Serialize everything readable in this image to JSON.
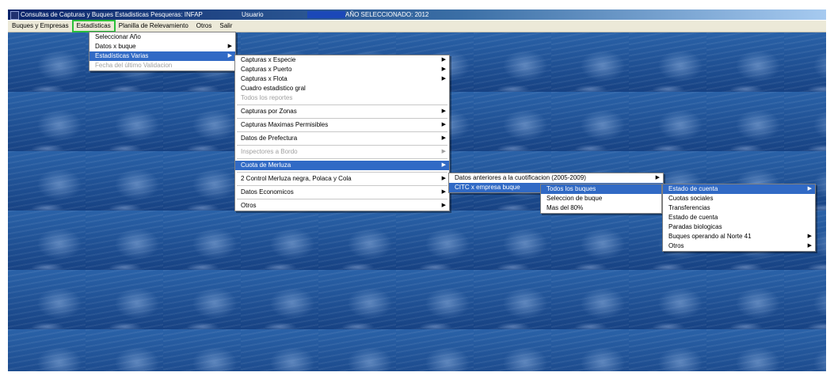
{
  "title_bar": {
    "app_title": "Consultas de Capturas y Buques Estadisticas Pesqueras: INFAP",
    "user": "Usuario",
    "year_text": "AÑO SELECCIONADO: 2012"
  },
  "menubar": {
    "items": [
      "Buques y Empresas",
      "Estadísticas",
      "Planilla de Relevamiento",
      "Otros",
      "Salir"
    ]
  },
  "menu_estadisticas": {
    "items": [
      {
        "label": "Seleccionar Año"
      },
      {
        "label": "Datos x buque"
      },
      {
        "label": "Estadísticas Varias"
      },
      {
        "label": "Fecha del último Validacion"
      }
    ]
  },
  "menu_varias": {
    "items": [
      {
        "label": "Capturas x Especie"
      },
      {
        "label": "Capturas x Puerto"
      },
      {
        "label": "Capturas x Flota"
      },
      {
        "label": "Cuadro estadistico gral"
      },
      {
        "label": "Todos los reportes"
      },
      {
        "label": "Capturas por Zonas"
      },
      {
        "label": "Capturas Maximas Permisibles"
      },
      {
        "label": "Datos de Prefectura"
      },
      {
        "label": "Inspectores a Bordo"
      },
      {
        "label": "Cuota de Merluza"
      },
      {
        "label": "2 Control Merluza negra, Polaca y Cola"
      },
      {
        "label": "Datos Economicos"
      },
      {
        "label": "Otros"
      }
    ]
  },
  "menu_cuota": {
    "items": [
      {
        "label": "Datos anteriores a la cuotificacion (2005-2009)"
      },
      {
        "label": "CITC x empresa buque"
      }
    ]
  },
  "menu_citc": {
    "items": [
      {
        "label": "Todos los buques"
      },
      {
        "label": "Seleccion de buque"
      },
      {
        "label": "Mas del 80%"
      }
    ]
  },
  "menu_todos": {
    "items": [
      {
        "label": "Estado de cuenta"
      },
      {
        "label": "Cuotas sociales"
      },
      {
        "label": "Transferencias"
      },
      {
        "label": "Estado de cuenta"
      },
      {
        "label": "Paradas biologicas"
      },
      {
        "label": "Buques operando al Norte 41"
      },
      {
        "label": "Otros"
      }
    ]
  }
}
